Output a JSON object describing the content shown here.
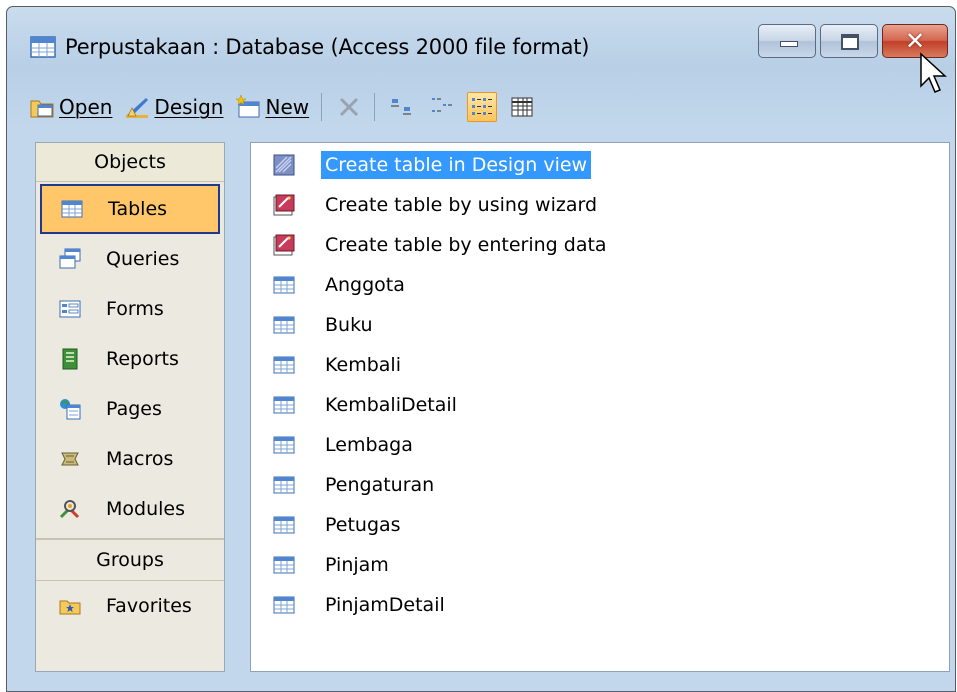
{
  "window": {
    "title": "Perpustakaan : Database (Access 2000 file format)",
    "close_glyph": "✕"
  },
  "toolbar": {
    "open_label": "Open",
    "design_label": "Design",
    "new_label": "New"
  },
  "objects": {
    "header": "Objects",
    "items": [
      {
        "label": "Tables",
        "icon": "table-icon",
        "selected": true
      },
      {
        "label": "Queries",
        "icon": "query-icon"
      },
      {
        "label": "Forms",
        "icon": "form-icon"
      },
      {
        "label": "Reports",
        "icon": "report-icon"
      },
      {
        "label": "Pages",
        "icon": "page-icon"
      },
      {
        "label": "Macros",
        "icon": "macro-icon"
      },
      {
        "label": "Modules",
        "icon": "module-icon"
      }
    ],
    "groups_header": "Groups",
    "groups": [
      {
        "label": "Favorites",
        "icon": "favorites-folder-icon"
      }
    ]
  },
  "list": {
    "items": [
      {
        "label": "Create table in Design view",
        "icon": "design-view-icon",
        "selected": true
      },
      {
        "label": "Create table by using wizard",
        "icon": "wizard-icon"
      },
      {
        "label": "Create table by entering data",
        "icon": "wizard-icon"
      },
      {
        "label": "Anggota",
        "icon": "table-icon"
      },
      {
        "label": "Buku",
        "icon": "table-icon"
      },
      {
        "label": "Kembali",
        "icon": "table-icon"
      },
      {
        "label": "KembaliDetail",
        "icon": "table-icon"
      },
      {
        "label": "Lembaga",
        "icon": "table-icon"
      },
      {
        "label": "Pengaturan",
        "icon": "table-icon"
      },
      {
        "label": "Petugas",
        "icon": "table-icon"
      },
      {
        "label": "Pinjam",
        "icon": "table-icon"
      },
      {
        "label": "PinjamDetail",
        "icon": "table-icon"
      }
    ]
  },
  "colors": {
    "selection": "#3399ff",
    "object_selected": "#ffc76a",
    "frame": "#c2d7ec"
  }
}
